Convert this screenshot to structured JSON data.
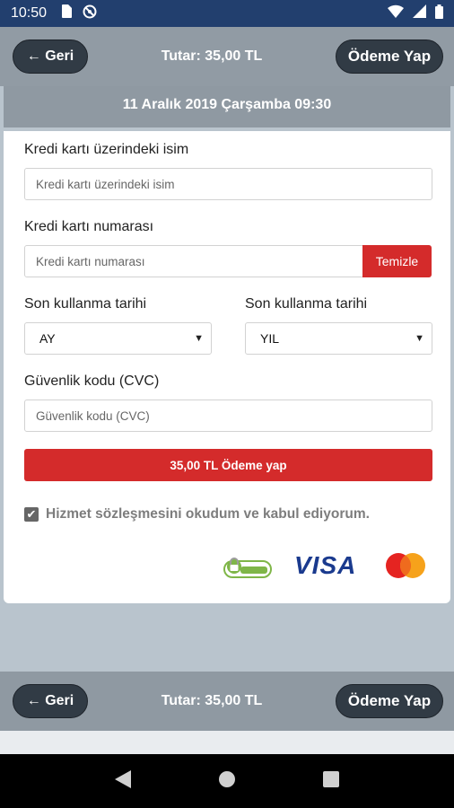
{
  "status_bar": {
    "time": "10:50",
    "left_icons": [
      "sim-card-icon",
      "do-not-disturb-icon"
    ],
    "right_icons": [
      "wifi-icon",
      "signal-icon",
      "battery-icon"
    ]
  },
  "header": {
    "back_label": "← Geri",
    "total_label": "Tutar: 35,00 TL",
    "pay_label": "Ödeme Yap"
  },
  "event": {
    "date_time": "11 Aralık 2019 Çarşamba 09:30"
  },
  "form": {
    "name_label": "Kredi kartı üzerindeki isim",
    "name_placeholder": "Kredi kartı üzerindeki isim",
    "number_label": "Kredi kartı numarası",
    "number_placeholder": "Kredi kartı numarası",
    "clear_label": "Temizle",
    "expiry_month_label": "Son kullanma tarihi",
    "expiry_month_value": "AY",
    "expiry_year_label": "Son kullanma tarihi",
    "expiry_year_value": "YIL",
    "cvc_label": "Güvenlik kodu (CVC)",
    "cvc_placeholder": "Güvenlik kodu (CVC)",
    "submit_label": "35,00 TL Ödeme yap",
    "agree_label": "Hizmet sözleşmesini okudum ve kabul ediyorum.",
    "agree_checked": true
  },
  "logos": [
    "secure-badge-icon",
    "visa-logo",
    "mastercard-logo"
  ],
  "logo_text": {
    "visa": "VISA"
  },
  "footer": {
    "back_label": "← Geri",
    "total_label": "Tutar: 35,00 TL",
    "pay_label": "Ödeme Yap"
  },
  "colors": {
    "status_bar": "#223f6e",
    "accent_red": "#d42b2b",
    "header_gray": "#919ba4",
    "pill_dark": "#313b45"
  }
}
